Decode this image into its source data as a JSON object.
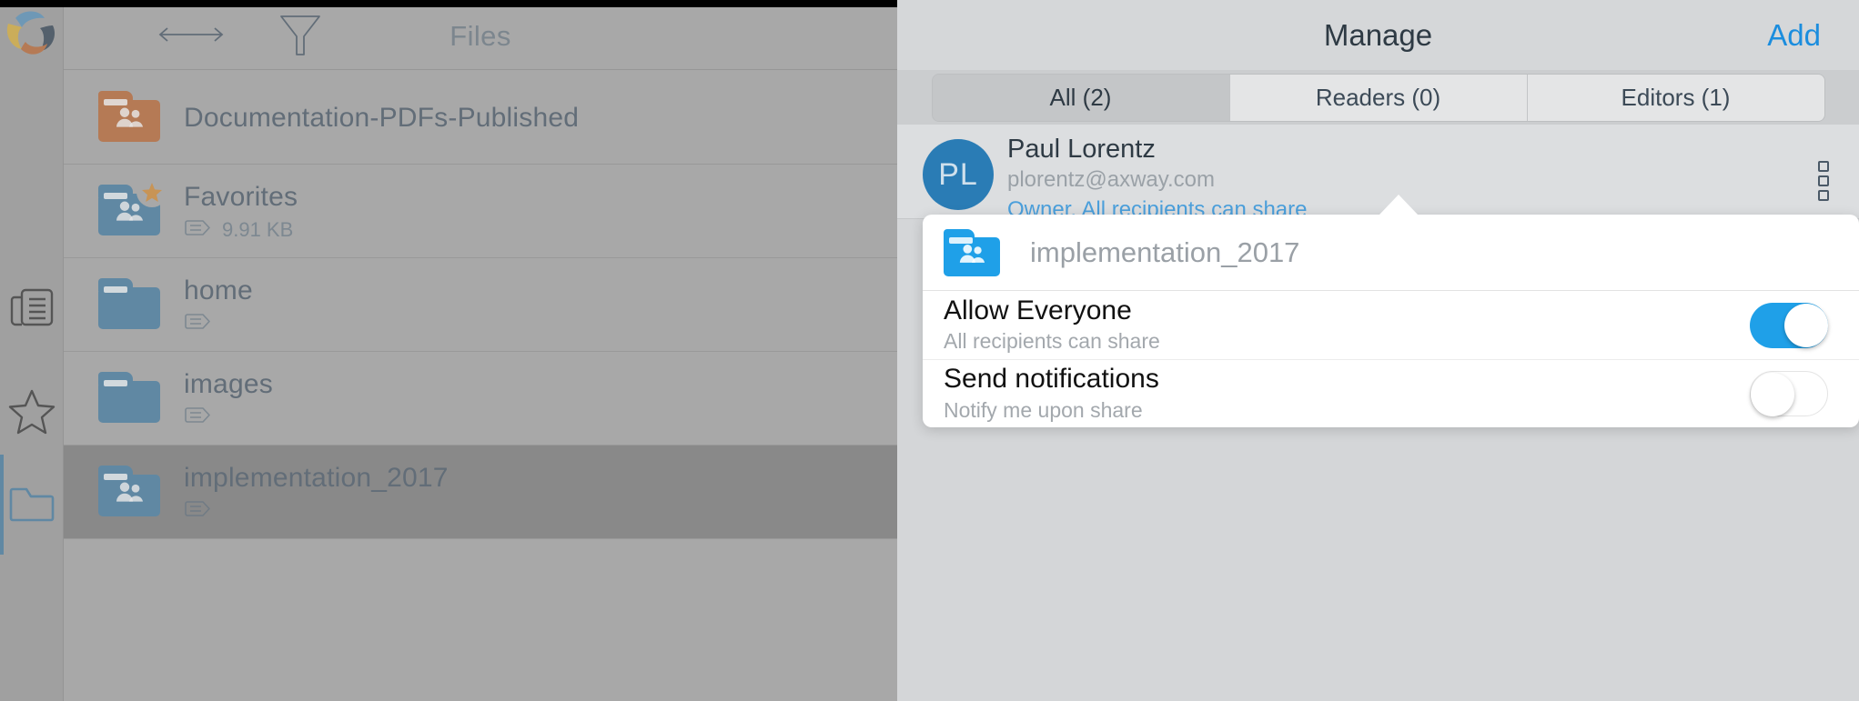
{
  "toolbar": {
    "title": "Files",
    "nav_arrows_icon": "left-right-arrows-icon",
    "filter_icon": "filter-funnel-icon"
  },
  "sidebar": {
    "logo_icon": "pinwheel-logo-icon",
    "items": [
      {
        "name": "activity",
        "icon": "news-document-icon"
      },
      {
        "name": "favorites",
        "icon": "star-outline-icon"
      },
      {
        "name": "files",
        "icon": "folder-outline-icon",
        "active": true
      }
    ]
  },
  "files": [
    {
      "name": "Documentation-PDFs-Published",
      "size": "",
      "icon": "shared-folder-orange-icon",
      "shared": true,
      "color": "#c27a4e",
      "favorite": false,
      "selected": false,
      "has_tag": false
    },
    {
      "name": "Favorites",
      "size": "9.91 KB",
      "icon": "shared-folder-blue-star-icon",
      "shared": true,
      "color": "#5b8cad",
      "favorite": true,
      "selected": false,
      "has_tag": true
    },
    {
      "name": "home",
      "size": "",
      "icon": "folder-blue-icon",
      "shared": false,
      "color": "#5b8cad",
      "favorite": false,
      "selected": false,
      "has_tag": true
    },
    {
      "name": "images",
      "size": "",
      "icon": "folder-blue-icon",
      "shared": false,
      "color": "#5b8cad",
      "favorite": false,
      "selected": false,
      "has_tag": true
    },
    {
      "name": "implementation_2017",
      "size": "",
      "icon": "shared-folder-blue-icon",
      "shared": true,
      "color": "#5b8cad",
      "favorite": false,
      "selected": true,
      "has_tag": true
    }
  ],
  "panel": {
    "title": "Manage",
    "add_label": "Add",
    "segments": [
      {
        "label": "All (2)",
        "active": true
      },
      {
        "label": "Readers (0)",
        "active": false
      },
      {
        "label": "Editors (1)",
        "active": false
      }
    ],
    "user": {
      "initials": "PL",
      "name": "Paul Lorentz",
      "email": "plorentz@axway.com",
      "role": "Owner, All recipients can share",
      "menu_icon": "overflow-menu-icon"
    }
  },
  "popover": {
    "folder_icon": "shared-folder-blue-icon",
    "folder_name": "implementation_2017",
    "rows": [
      {
        "label": "Allow Everyone",
        "sub": "All recipients can share",
        "state": "on"
      },
      {
        "label": "Send notifications",
        "sub": "Notify me upon share",
        "state": "off"
      }
    ]
  },
  "colors": {
    "accent_blue": "#1fa0e8",
    "link_blue": "#1b8dde",
    "folder_blue": "#5b8cad",
    "folder_orange": "#c27a4e",
    "avatar_blue": "#2a7cb5"
  }
}
